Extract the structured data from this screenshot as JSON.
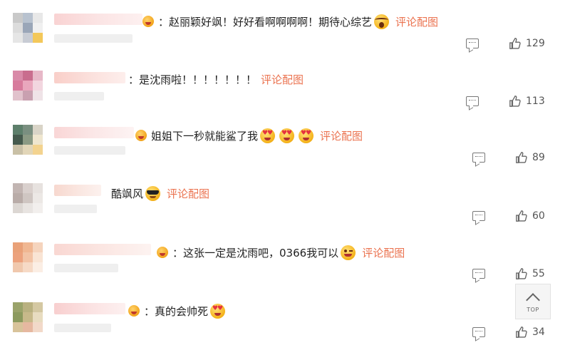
{
  "comments": [
    {
      "avatar": [
        "#c9c9c9",
        "#b8c2cf",
        "#e8e8e8",
        "#dcdcdc",
        "#9aa6b8",
        "#f0f0f0",
        "#e6e6e6",
        "#c8ccd4",
        "#f3c85a"
      ],
      "name_color": "#f8c9c9",
      "text": "：赵丽颖好飒！好好看啊啊啊啊！期待心综艺",
      "link": "评论配图",
      "likes": "129",
      "mood": "heart-eyes",
      "emojis": [
        "shocked"
      ]
    },
    {
      "avatar": [
        "#d98aa8",
        "#c96d8e",
        "#e7b8c8",
        "#d77b9c",
        "#e9a7bd",
        "#f2d6df",
        "#e1c2cc",
        "#c9a0b0",
        "#efe3e7"
      ],
      "name_color": "#f7c5c0",
      "text": "：是沈雨啦！！！！！！！",
      "link": "评论配图",
      "likes": "113",
      "mood": "",
      "emojis": []
    },
    {
      "avatar": [
        "#5d7f6b",
        "#7a8f80",
        "#d9d4c7",
        "#455a4d",
        "#8b9a84",
        "#efe6cf",
        "#c9c0a6",
        "#e2d6b8",
        "#f3d38f"
      ],
      "name_color": "#f6cfcf",
      "text": "姐姐下一秒就能鲨了我",
      "link": "评论配图",
      "likes": "89",
      "mood": "heart-eyes",
      "emojis": [
        "heart-eyes",
        "heart-eyes",
        "heart-eyes"
      ]
    },
    {
      "avatar": [
        "#c2b5b2",
        "#d9d0cd",
        "#e7e2df",
        "#b9aca8",
        "#cfc6c2",
        "#ece8e5",
        "#dcd7d3",
        "#e8e4e1",
        "#f2efed"
      ],
      "name_color": "#f4cdc4",
      "text": "酷飒风",
      "link": "评论配图",
      "likes": "60",
      "mood": "",
      "emojis": [
        "cool"
      ]
    },
    {
      "avatar": [
        "#e9a178",
        "#f0b792",
        "#f5d4bd",
        "#eca27d",
        "#f2c3a5",
        "#f9e4d4",
        "#f0c8ad",
        "#f6dac6",
        "#fbeee4"
      ],
      "name_color": "#f7cfc8",
      "text": "：这张一定是沈雨吧，0366我可以",
      "link": "评论配图",
      "likes": "55",
      "mood": "heart-eyes",
      "emojis": [
        "wink"
      ]
    },
    {
      "avatar": [
        "#9aa36a",
        "#b9b180",
        "#d4c8a2",
        "#8c9a5e",
        "#c7b98a",
        "#e8dcc0",
        "#d8c39a",
        "#e6b8a0",
        "#f2d9c9"
      ],
      "name_color": "#f7c3c3",
      "text": "：真的会帅死",
      "link": "评论配图",
      "likes": "34",
      "mood": "heart-eyes",
      "emojis": [
        "heart-eyes"
      ]
    }
  ],
  "top_button": {
    "label": "TOP"
  },
  "icons": {
    "reply": "comment-icon",
    "like": "thumbs-up-icon",
    "back_to_top": "arrow-up-icon"
  },
  "colors": {
    "link": "#eb7350",
    "text": "#222222",
    "meta": "#555555"
  }
}
